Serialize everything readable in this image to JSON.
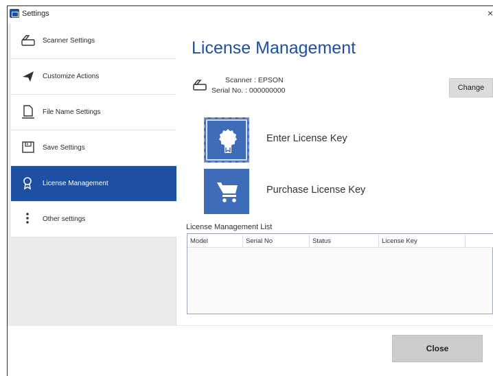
{
  "window": {
    "title": "Settings",
    "close_glyph": "×"
  },
  "sidebar": {
    "items": [
      {
        "label": "Scanner Settings",
        "icon": "scanner-icon"
      },
      {
        "label": "Customize Actions",
        "icon": "send-icon"
      },
      {
        "label": "File Name Settings",
        "icon": "file-icon"
      },
      {
        "label": "Save Settings",
        "icon": "save-icon"
      },
      {
        "label": "License Management",
        "icon": "award-icon",
        "active": true
      },
      {
        "label": "Other settings",
        "icon": "more-vertical-icon"
      }
    ]
  },
  "main": {
    "title": "License Management",
    "scanner": {
      "name": "Scanner : EPSON",
      "serial": "Serial No. : 000000000",
      "change_label": "Change"
    },
    "actions": [
      {
        "label": "Enter License Key",
        "icon": "certificate-icon"
      },
      {
        "label": "Purchase License Key",
        "icon": "cart-icon"
      }
    ],
    "list": {
      "title": "License Management List",
      "columns": [
        "Model",
        "Serial No",
        "Status",
        "License Key",
        ""
      ],
      "rows": []
    }
  },
  "footer": {
    "close_label": "Close"
  },
  "colors": {
    "accent": "#1d4fa3",
    "tile": "#3f6cb8"
  }
}
